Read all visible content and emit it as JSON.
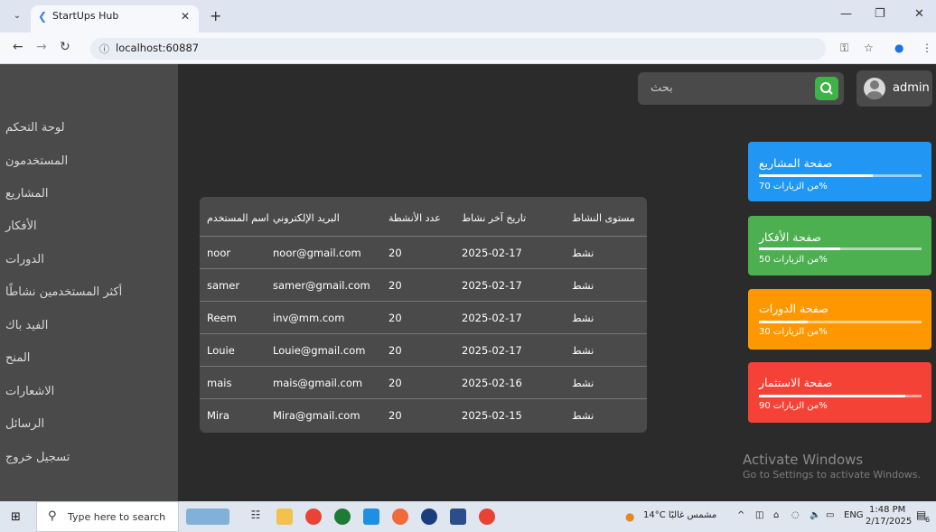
{
  "browser": {
    "tab_title": "StartUps Hub",
    "url": "localhost:60887"
  },
  "sidebar": {
    "items": [
      {
        "label": "لوحة التحكم"
      },
      {
        "label": "المستخدمون"
      },
      {
        "label": "المشاريع"
      },
      {
        "label": "الأفكار"
      },
      {
        "label": "الدورات"
      },
      {
        "label": "أكثر المستخدمين نشاطًا"
      },
      {
        "label": "الفيد باك"
      },
      {
        "label": "المنح"
      },
      {
        "label": "الاشعارات"
      },
      {
        "label": "الرسائل"
      },
      {
        "label": "تسجيل خروج"
      }
    ]
  },
  "header": {
    "search_placeholder": "بحث",
    "user_name": "admin"
  },
  "table": {
    "headers": [
      "اسم المستخدم",
      "البريد الإلكتروني",
      "عدد الأنشطة",
      "تاريخ آخر نشاط",
      "مستوى النشاط"
    ],
    "rows": [
      [
        "noor",
        "noor@gmail.com",
        "20",
        "2025-02-17",
        "نشط"
      ],
      [
        "samer",
        "samer@gmail.com",
        "20",
        "2025-02-17",
        "نشط"
      ],
      [
        "Reem",
        "inv@mm.com",
        "20",
        "2025-02-17",
        "نشط"
      ],
      [
        "Louie",
        "Louie@gmail.com",
        "20",
        "2025-02-17",
        "نشط"
      ],
      [
        "mais",
        "mais@gmail.com",
        "20",
        "2025-02-16",
        "نشط"
      ],
      [
        "Mira",
        "Mira@gmail.com",
        "20",
        "2025-02-15",
        "نشط"
      ]
    ]
  },
  "cards": [
    {
      "title": "صفحة المشاريع",
      "subtitle": "من الزيارات 70%",
      "progress": 0.7,
      "color": "#2196f3"
    },
    {
      "title": "صفحة الأفكار",
      "subtitle": "من الزيارات 50%",
      "progress": 0.5,
      "color": "#4caf50"
    },
    {
      "title": "صفحة الدورات",
      "subtitle": "من الزيارات 30%",
      "progress": 0.3,
      "color": "#ff9800"
    },
    {
      "title": "صفحة الاستثمار",
      "subtitle": "من الزيارات 90%",
      "progress": 0.9,
      "color": "#f44336"
    }
  ],
  "watermark": {
    "title": "Activate Windows",
    "subtitle": "Go to Settings to activate Windows."
  },
  "taskbar": {
    "search_placeholder": "Type here to search",
    "weather": "14°C مشمس غالبًا",
    "lang": "ENG",
    "time": "1:48 PM",
    "date": "2/17/2025",
    "notif_count": "6"
  }
}
